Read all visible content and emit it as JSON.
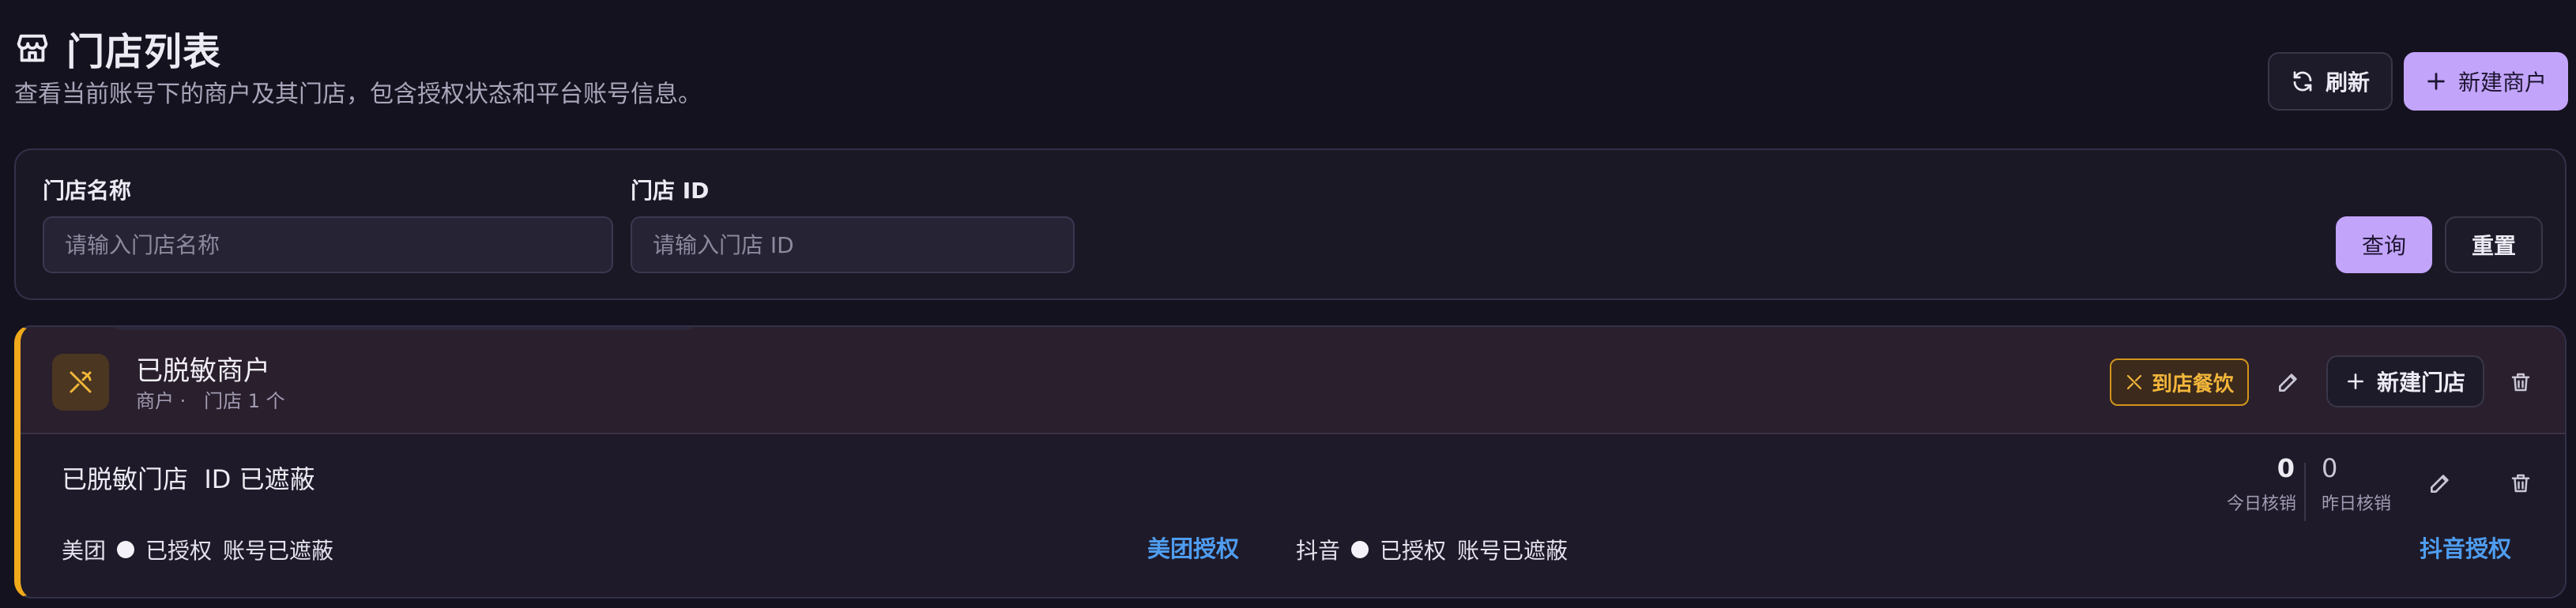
{
  "header": {
    "title": "门店列表",
    "description": "查看当前账号下的商户及其门店，包含授权状态和平台账号信息。",
    "refresh_label": "刷新",
    "new_merchant_label": "新建商户"
  },
  "filters": {
    "store_name_label": "门店名称",
    "store_name_placeholder": "请输入门店名称",
    "store_name_value": "",
    "store_id_label": "门店 ID",
    "store_id_placeholder": "请输入门店 ID",
    "store_id_value": "",
    "query_label": "查询",
    "reset_label": "重置"
  },
  "merchant": {
    "name": "已脱敏商户",
    "subtitle": "商户 ·   门店 1 个",
    "category_tag": "到店餐饮",
    "new_store_label": "新建门店",
    "accent_color": "#f0a91b",
    "store": {
      "name": "已脱敏门店  ID 已遮蔽",
      "today_count": "0",
      "today_label": "今日核销",
      "yesterday_count": "0",
      "yesterday_label": "昨日核销",
      "meituan": {
        "platform": "美团",
        "status": "已授权",
        "account": "账号已遮蔽",
        "auth_link": "美团授权"
      },
      "douyin": {
        "platform": "抖音",
        "status": "已授权",
        "account": "账号已遮蔽",
        "auth_link": "抖音授权"
      }
    }
  },
  "colors": {
    "background": "#15121f",
    "primary": "#c3a4fb",
    "link": "#4f9df0",
    "tag": "#f3b63a"
  },
  "icons": [
    "store-icon",
    "refresh-icon",
    "plus-icon",
    "utensils-icon",
    "pencil-icon",
    "trash-icon"
  ]
}
